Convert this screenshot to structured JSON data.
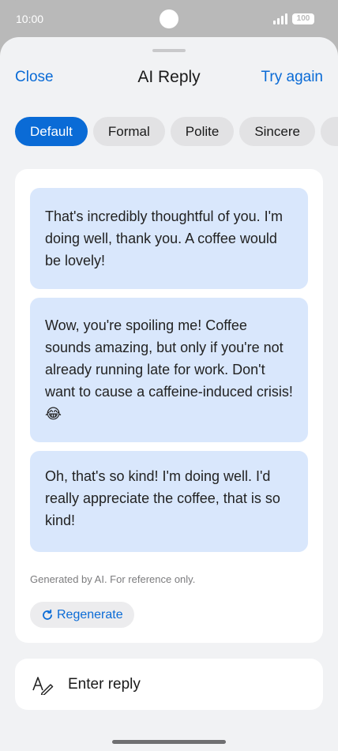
{
  "status_bar": {
    "time": "10:00",
    "battery": "100"
  },
  "header": {
    "close_label": "Close",
    "title": "AI Reply",
    "try_again_label": "Try again"
  },
  "tones": [
    {
      "label": "Default",
      "active": true
    },
    {
      "label": "Formal",
      "active": false
    },
    {
      "label": "Polite",
      "active": false
    },
    {
      "label": "Sincere",
      "active": false
    }
  ],
  "suggestions": [
    "That's incredibly thoughtful of you. I'm doing well, thank you.  A coffee would be lovely!",
    "Wow, you're spoiling me! Coffee sounds amazing, but only if you're not already running late for work.  Don't want to cause a caffeine-induced crisis! 😂",
    "Oh, that's so kind! I'm doing well.  I'd really appreciate the coffee, that is so kind!"
  ],
  "disclaimer": "Generated by AI. For reference only.",
  "regenerate_label": "Regenerate",
  "reply": {
    "placeholder": "Enter reply"
  },
  "colors": {
    "accent": "#0a6bd6",
    "bubble": "#d9e7fc",
    "sheet": "#f1f2f4"
  }
}
